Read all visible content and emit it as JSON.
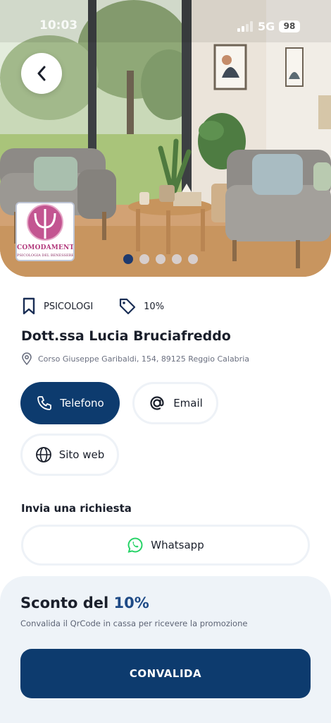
{
  "status_bar": {
    "time": "10:03",
    "network": "5G",
    "battery": "98"
  },
  "gallery": {
    "slide_count": 5,
    "active_index": 0
  },
  "logo": {
    "name": "COMODAMENTE",
    "subtitle": "PSICOLOGIA DEL BENESSERE"
  },
  "category": {
    "label": "PSICOLOGI",
    "icon": "bookmark-icon"
  },
  "discount_tag": {
    "label": "10%",
    "icon": "tag-icon"
  },
  "business": {
    "name": "Dott.ssa Lucia Bruciafreddo",
    "address": "Corso Giuseppe Garibaldi, 154, 89125 Reggio Calabria"
  },
  "contacts": {
    "phone_label": "Telefono",
    "email_label": "Email",
    "website_label": "Sito web"
  },
  "request": {
    "title": "Invia una richiesta",
    "whatsapp_label": "Whatsapp"
  },
  "promo": {
    "title_prefix": "Sconto del ",
    "percent": "10%",
    "description": "Convalida il QrCode in cassa per ricevere la promozione",
    "button_label": "CONVALIDA"
  },
  "colors": {
    "primary": "#0d3b6e",
    "accent": "#1e4a86",
    "sheet_bg": "#eef3f8",
    "whatsapp": "#25d366"
  }
}
